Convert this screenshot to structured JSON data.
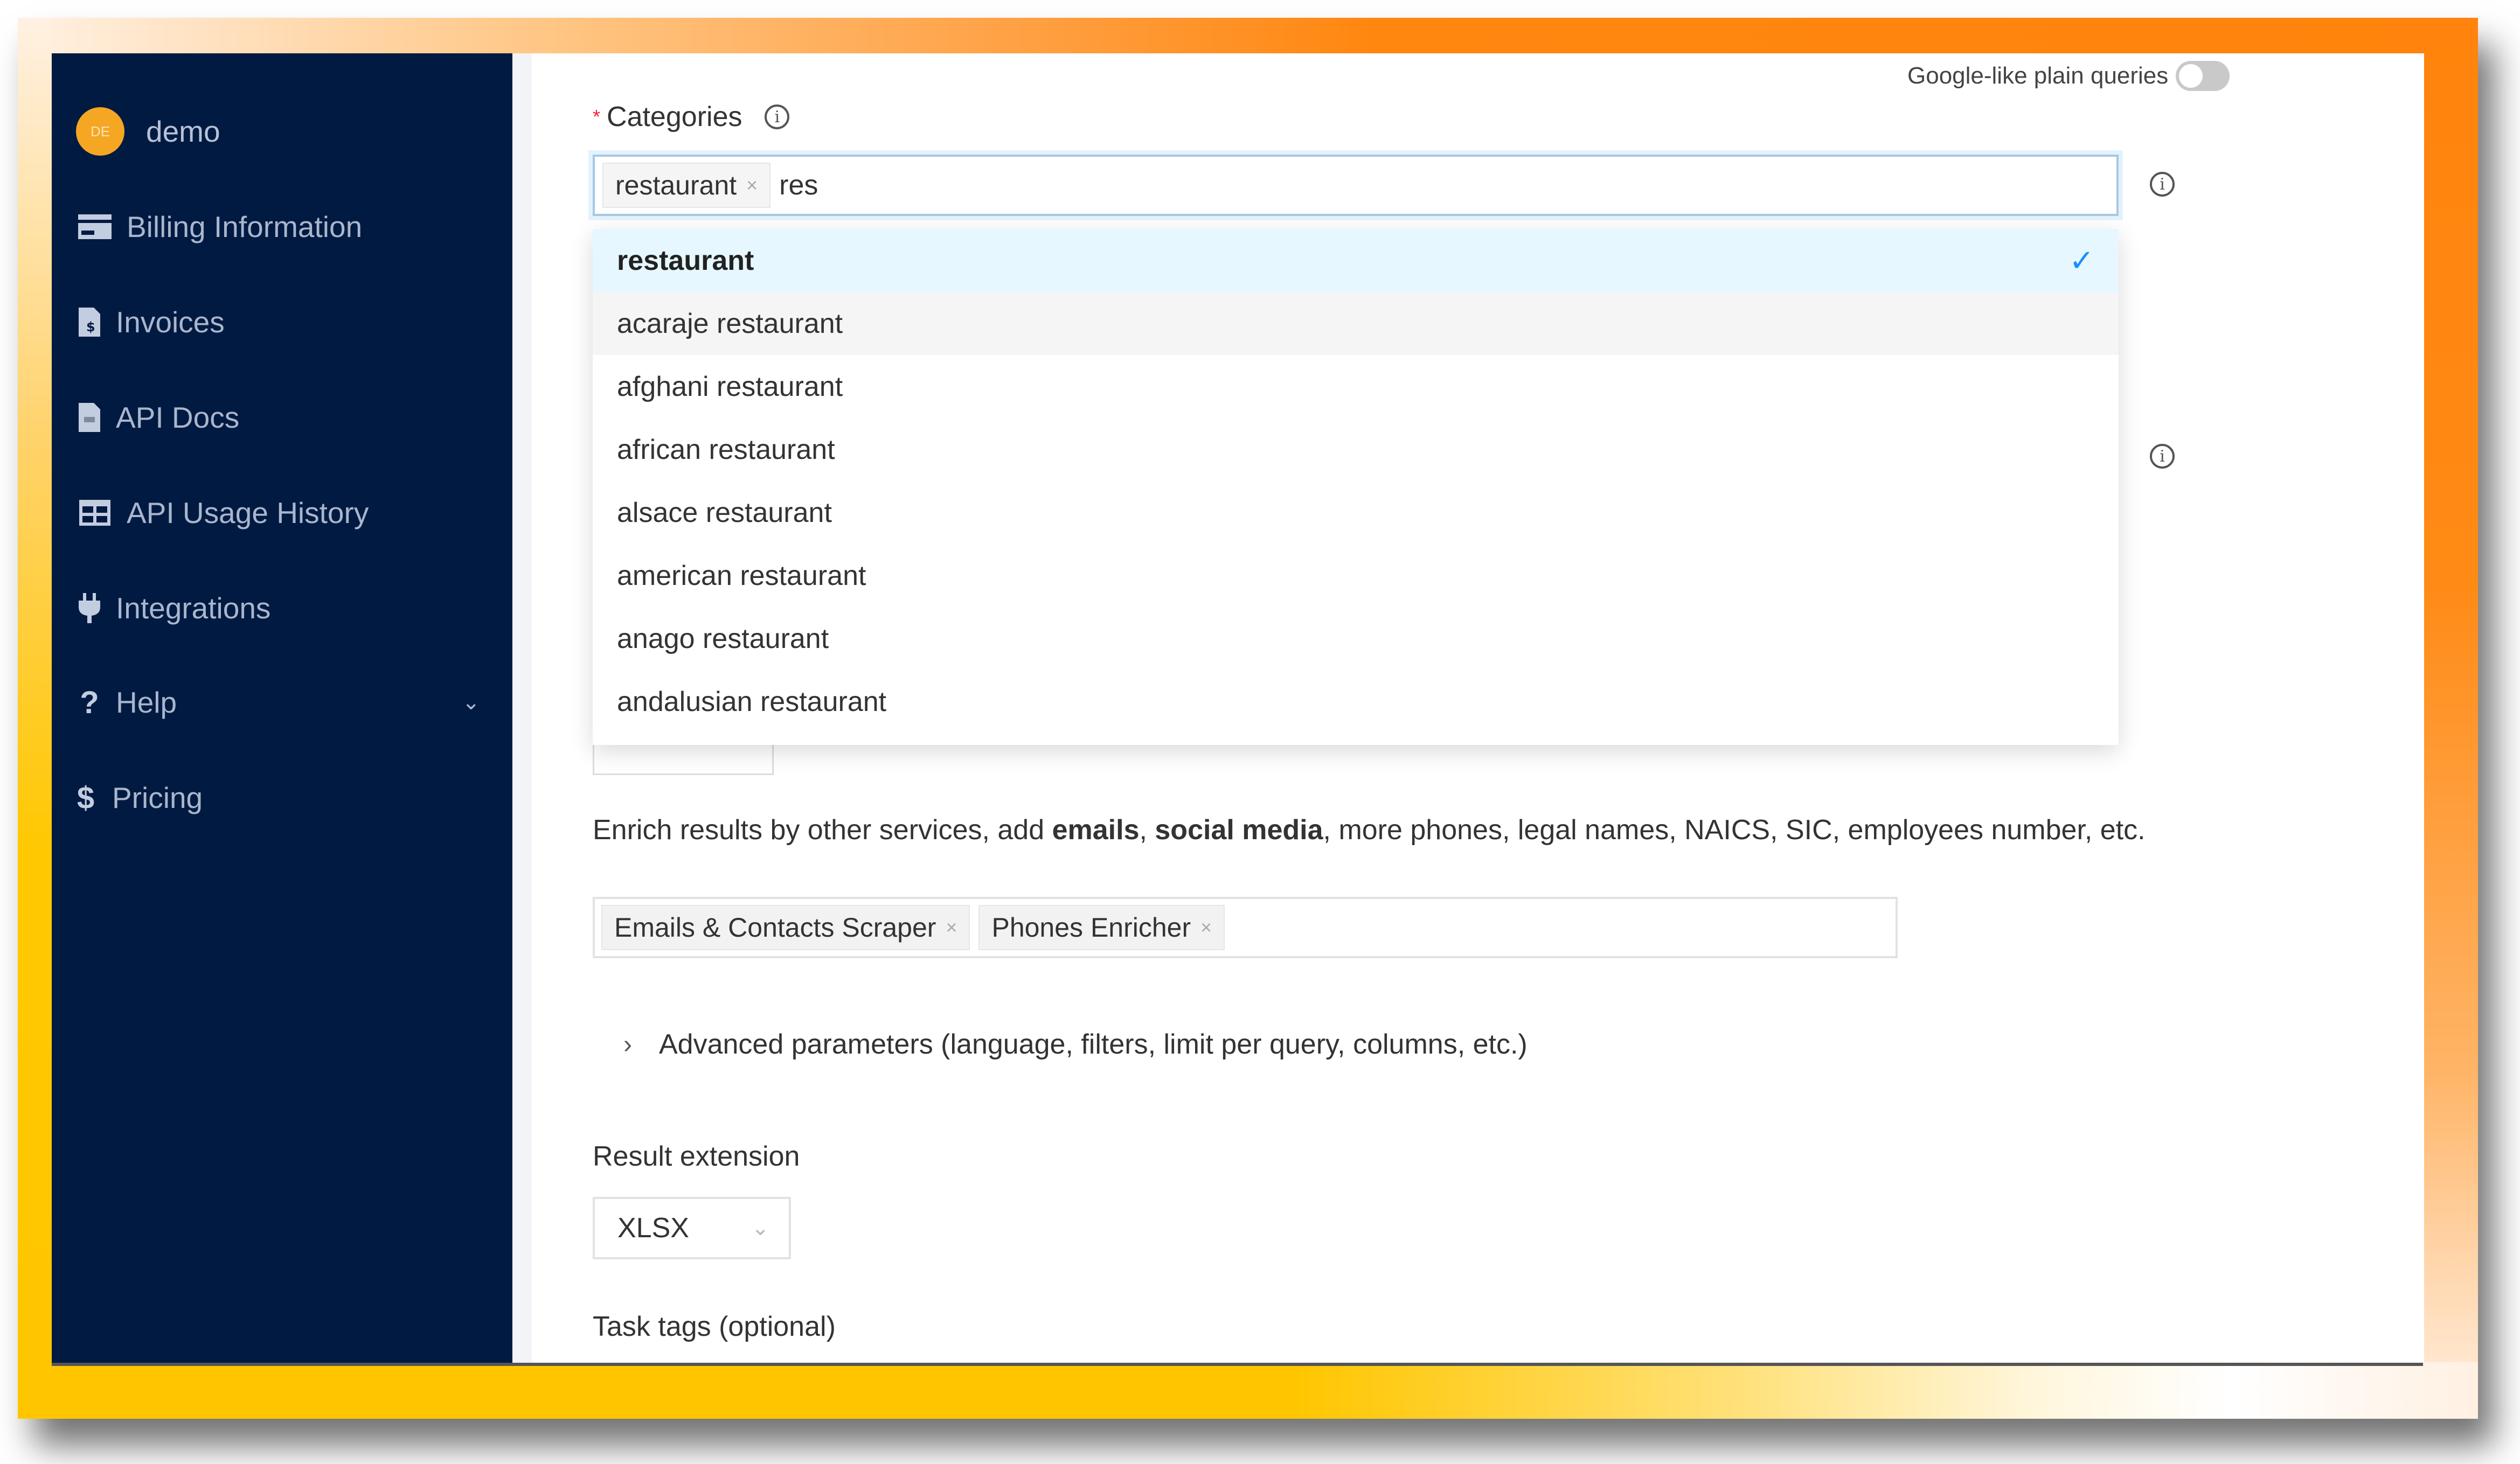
{
  "sidebar": {
    "user": {
      "initials": "DE",
      "name": "demo"
    },
    "items": [
      {
        "label": "Billing Information",
        "icon": "credit-card-icon"
      },
      {
        "label": "Invoices",
        "icon": "invoice-file-icon"
      },
      {
        "label": "API Docs",
        "icon": "document-icon"
      },
      {
        "label": "API Usage History",
        "icon": "table-icon"
      },
      {
        "label": "Integrations",
        "icon": "plug-icon"
      },
      {
        "label": "Help",
        "icon": "question-icon",
        "has_submenu": true
      },
      {
        "label": "Pricing",
        "icon": "dollar-icon"
      }
    ]
  },
  "main": {
    "toggle": {
      "label": "Google-like plain queries",
      "on": false
    },
    "categories": {
      "label": "Categories",
      "required": true,
      "selected_tags": [
        "restaurant"
      ],
      "input_value": "res",
      "options": [
        {
          "label": "restaurant",
          "selected": true
        },
        {
          "label": "acaraje restaurant",
          "hovered": true
        },
        {
          "label": "afghani restaurant"
        },
        {
          "label": "african restaurant"
        },
        {
          "label": "alsace restaurant"
        },
        {
          "label": "american restaurant"
        },
        {
          "label": "anago restaurant"
        },
        {
          "label": "andalusian restaurant"
        }
      ]
    },
    "enrich": {
      "text_before": "Enrich results by other services, add ",
      "bold1": "emails",
      "sep": ", ",
      "bold2": "social media",
      "text_after": ", more phones, legal names, NAICS, SIC, employees number, etc.",
      "tags": [
        "Emails & Contacts Scraper",
        "Phones Enricher"
      ]
    },
    "advanced": {
      "label": "Advanced parameters (language, filters, limit per query, columns, etc.)"
    },
    "result_extension": {
      "label": "Result extension",
      "value": "XLSX"
    },
    "task_tags": {
      "label": "Task tags (optional)"
    },
    "colors": {
      "sidebar_bg": "#011a42",
      "accent": "#1890ff",
      "avatar": "#f5a623"
    }
  }
}
